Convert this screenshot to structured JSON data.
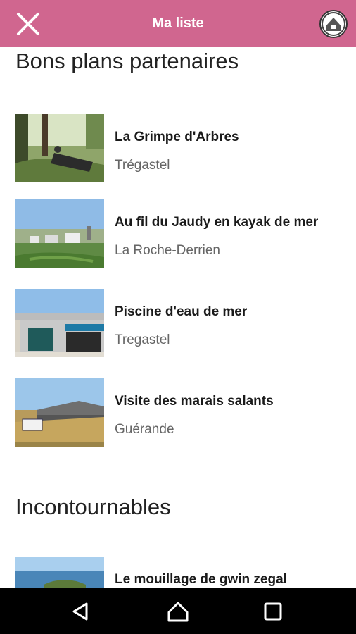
{
  "app": {
    "title": "Ma liste"
  },
  "icons": {
    "close": "close-icon",
    "logo": "app-logo",
    "back": "back-triangle-icon",
    "home": "home-icon",
    "recents": "recents-square-icon"
  },
  "colors": {
    "appbar": "#d0668f",
    "navbar": "#000000"
  },
  "sections": [
    {
      "title": "Bons plans partenaires",
      "items": [
        {
          "title": "La Grimpe d'Arbres",
          "location": "Trégastel"
        },
        {
          "title": "Au fil du Jaudy en kayak de mer",
          "location": "La Roche-Derrien"
        },
        {
          "title": "Piscine d'eau de mer",
          "location": "Tregastel"
        },
        {
          "title": "Visite des marais salants",
          "location": "Guérande"
        }
      ]
    },
    {
      "title": "Incontournables",
      "items": [
        {
          "title": "Le mouillage de gwin zegal",
          "location": ""
        }
      ]
    }
  ]
}
